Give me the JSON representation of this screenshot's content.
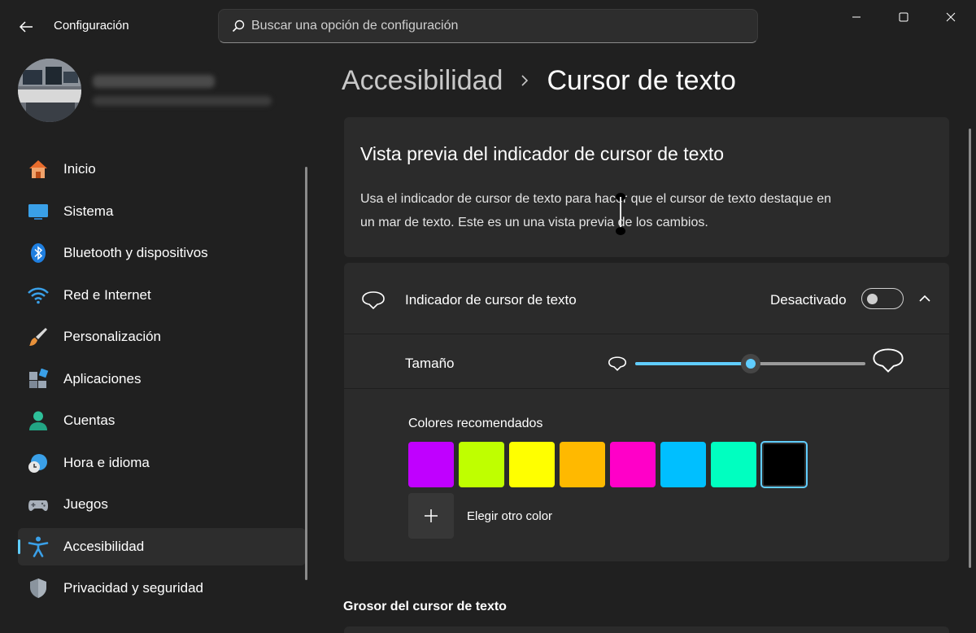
{
  "window": {
    "app_title": "Configuración",
    "controls": [
      "minimize",
      "maximize",
      "close"
    ]
  },
  "search": {
    "placeholder": "Buscar una opción de configuración"
  },
  "sidebar": {
    "items": [
      {
        "label": "Inicio",
        "icon": "home-icon"
      },
      {
        "label": "Sistema",
        "icon": "monitor-icon"
      },
      {
        "label": "Bluetooth y dispositivos",
        "icon": "bluetooth-icon"
      },
      {
        "label": "Red e Internet",
        "icon": "wifi-icon"
      },
      {
        "label": "Personalización",
        "icon": "paintbrush-icon"
      },
      {
        "label": "Aplicaciones",
        "icon": "apps-icon"
      },
      {
        "label": "Cuentas",
        "icon": "person-icon"
      },
      {
        "label": "Hora e idioma",
        "icon": "globe-clock-icon"
      },
      {
        "label": "Juegos",
        "icon": "gamepad-icon"
      },
      {
        "label": "Accesibilidad",
        "icon": "accessibility-icon",
        "active": true
      },
      {
        "label": "Privacidad y seguridad",
        "icon": "shield-icon"
      }
    ]
  },
  "breadcrumb": {
    "parent": "Accesibilidad",
    "current": "Cursor de texto"
  },
  "preview": {
    "title": "Vista previa del indicador de cursor de texto",
    "description": "Usa el indicador de cursor de texto para hacer que el cursor de texto destaque en un mar de texto. Este es un una vista previa de los cambios."
  },
  "indicator": {
    "label": "Indicador de cursor de texto",
    "state_label": "Desactivado",
    "enabled": false,
    "size_label": "Tamaño",
    "size_fraction": 0.5,
    "colors_label": "Colores recomendados",
    "colors": [
      "#c000ff",
      "#bfff00",
      "#ffff00",
      "#ffb900",
      "#ff00c8",
      "#00bfff",
      "#00ffc0",
      "#000000"
    ],
    "selected_color_index": 7,
    "add_color_label": "Elegir otro color"
  },
  "thickness": {
    "heading": "Grosor del cursor de texto"
  },
  "colors": {
    "accent": "#60cdff",
    "background": "#202020",
    "card": "#2b2b2b"
  }
}
